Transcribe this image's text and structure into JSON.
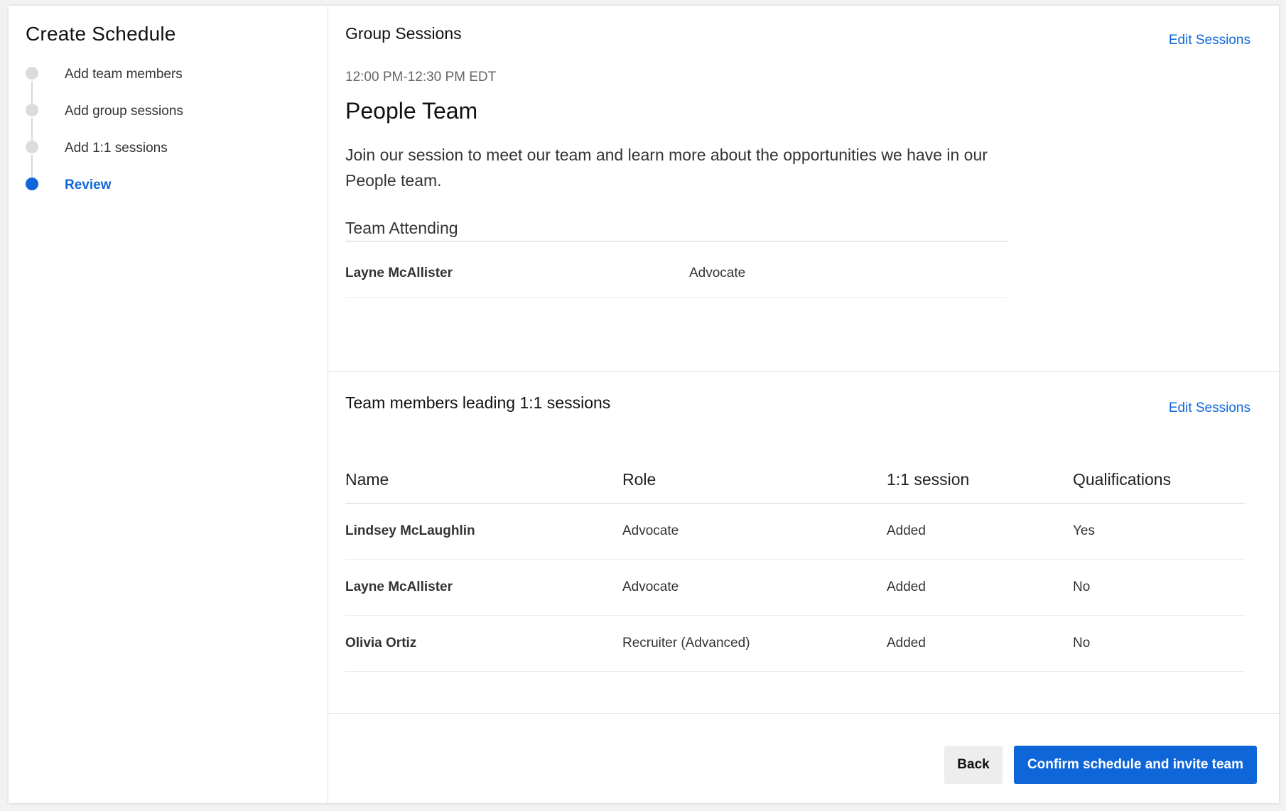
{
  "sidebar": {
    "title": "Create Schedule",
    "steps": [
      {
        "label": "Add team members",
        "state": "done"
      },
      {
        "label": "Add group sessions",
        "state": "done"
      },
      {
        "label": "Add 1:1 sessions",
        "state": "done"
      },
      {
        "label": "Review",
        "state": "active"
      }
    ]
  },
  "group_sessions": {
    "title": "Group Sessions",
    "edit_label": "Edit Sessions",
    "time": "12:00 PM-12:30 PM EDT",
    "team_name": "People Team",
    "description": "Join our session to meet our team and learn more about the opportunities we have in our People team.",
    "attending_label": "Team Attending",
    "attending": [
      {
        "name": "Layne McAllister",
        "role": "Advocate"
      }
    ]
  },
  "one_on_one": {
    "title": "Team members leading 1:1 sessions",
    "edit_label": "Edit Sessions",
    "columns": [
      "Name",
      "Role",
      "1:1 session",
      "Qualifications"
    ],
    "rows": [
      {
        "name": "Lindsey McLaughlin",
        "role": "Advocate",
        "session": "Added",
        "qualifications": "Yes"
      },
      {
        "name": "Layne McAllister",
        "role": "Advocate",
        "session": "Added",
        "qualifications": "No"
      },
      {
        "name": "Olivia Ortiz",
        "role": "Recruiter (Advanced)",
        "session": "Added",
        "qualifications": "No"
      }
    ]
  },
  "footer": {
    "back_label": "Back",
    "confirm_label": "Confirm schedule and invite team"
  },
  "colors": {
    "accent": "#0f66d9",
    "step_inactive": "#dcdcdc",
    "back_button_bg": "#ededed"
  }
}
